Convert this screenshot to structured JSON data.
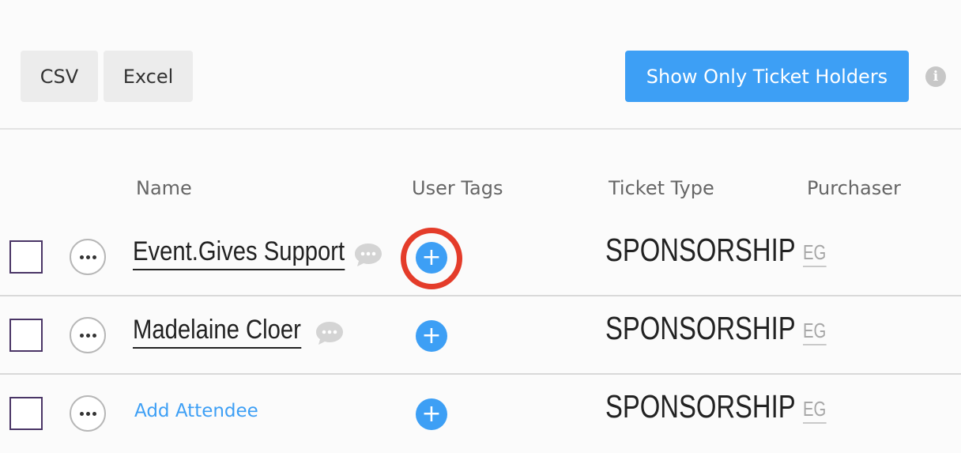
{
  "toolbar": {
    "csv_label": "CSV",
    "excel_label": "Excel",
    "show_ticket_holders_label": "Show Only Ticket Holders",
    "info_glyph": "i"
  },
  "table": {
    "headers": {
      "name": "Name",
      "user_tags": "User Tags",
      "ticket_type": "Ticket Type",
      "purchaser": "Purchaser"
    },
    "rows": [
      {
        "name": "Event.Gives Support",
        "ticket_type": "SPONSORSHIP",
        "purchaser": "EG",
        "tag_add": "+"
      },
      {
        "name": "Madelaine Cloer",
        "ticket_type": "SPONSORSHIP",
        "purchaser": "EG",
        "tag_add": "+"
      },
      {
        "name": "Add Attendee",
        "ticket_type": "SPONSORSHIP",
        "purchaser": "EG",
        "tag_add": "+"
      }
    ]
  },
  "colors": {
    "accent_blue": "#3d9ff5",
    "highlight_red": "#e43c2a",
    "checkbox_border": "#4a3566"
  },
  "icons": {
    "info": "info-icon",
    "more": "more-horizontal-icon",
    "comment": "comment-bubble-icon",
    "add": "plus-circle-icon"
  }
}
